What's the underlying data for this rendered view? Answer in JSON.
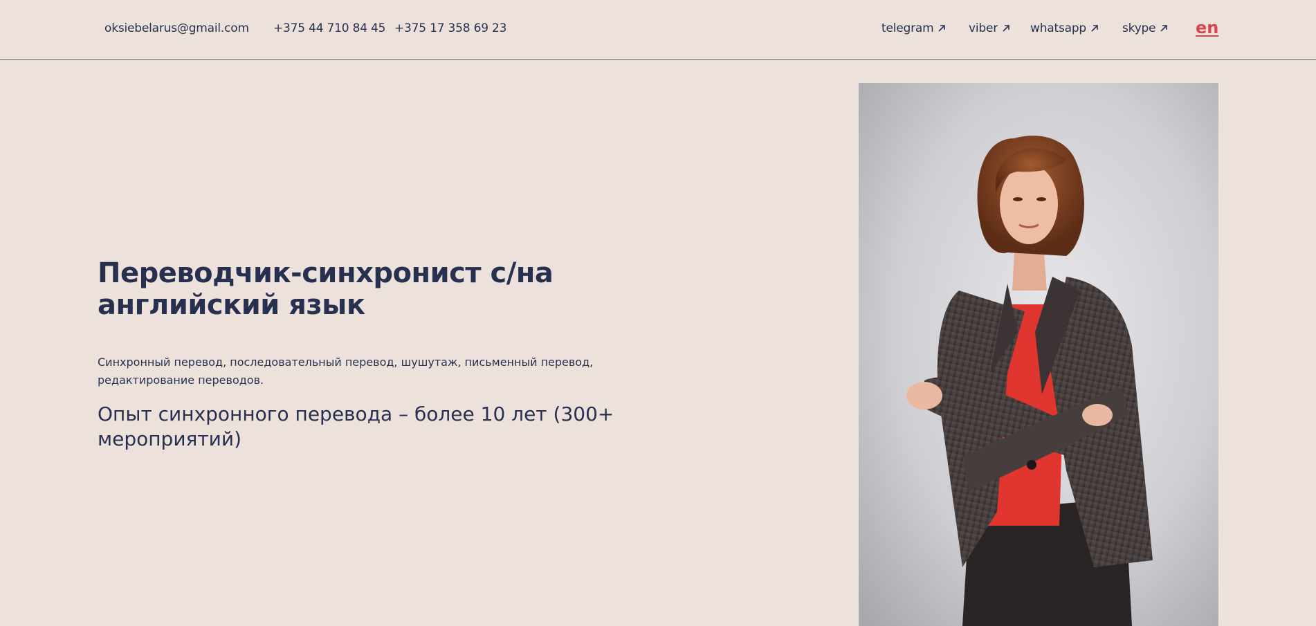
{
  "header": {
    "email": "oksiebelarus@gmail.com",
    "phone_1": "+375 44 710 84 45",
    "phone_2": "+375 17 358 69 23",
    "social": [
      {
        "label": "telegram",
        "icon": "arrow-up-right-icon"
      },
      {
        "label": "viber",
        "icon": "arrow-up-right-icon"
      },
      {
        "label": "whatsapp",
        "icon": "arrow-up-right-icon"
      },
      {
        "label": "skype",
        "icon": "arrow-up-right-icon"
      }
    ],
    "language": "en"
  },
  "hero": {
    "title": "Переводчик-синхронист с/на английский язык",
    "description": "Синхронный перевод, последовательный перевод, шушутаж, письменный перевод, редактирование переводов.",
    "experience": "Опыт синхронного перевода – более 10 лет (300+ мероприятий)"
  },
  "colors": {
    "background": "#ede2db",
    "text": "#283050",
    "accent": "#d94452"
  }
}
